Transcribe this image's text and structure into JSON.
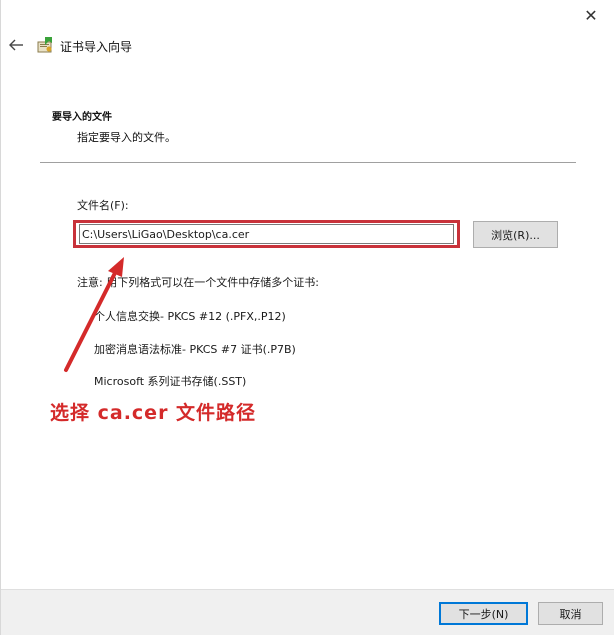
{
  "window": {
    "close_glyph": "✕"
  },
  "header": {
    "title": "证书导入向导"
  },
  "section": {
    "title": "要导入的文件",
    "subtitle": "指定要导入的文件。"
  },
  "file": {
    "label": "文件名(F):",
    "value": "C:\\Users\\LiGao\\Desktop\\ca.cer",
    "browse_label": "浏览(R)..."
  },
  "note": "注意: 用下列格式可以在一个文件中存储多个证书:",
  "formats": [
    "个人信息交换- PKCS #12 (.PFX,.P12)",
    "加密消息语法标准- PKCS #7 证书(.P7B)",
    "Microsoft 系列证书存储(.SST)"
  ],
  "annotation": {
    "text": "选择 ca.cer 文件路径",
    "color": "#d42a2a"
  },
  "footer": {
    "next_label": "下一步(N)",
    "cancel_label": "取消"
  },
  "colors": {
    "highlight_border": "#c8323a",
    "focus_blue": "#0078d7"
  }
}
